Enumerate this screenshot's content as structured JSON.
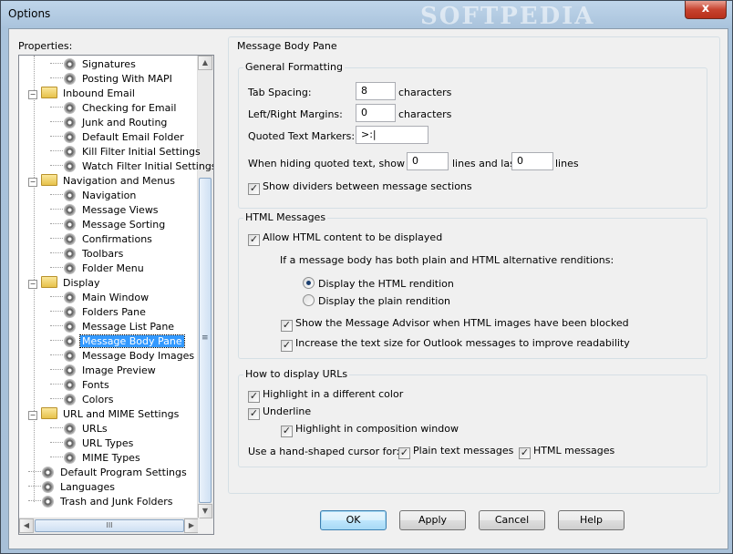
{
  "window": {
    "title": "Options",
    "watermark": "SOFTPEDIA",
    "close_label": "x"
  },
  "left": {
    "properties_label": "Properties:"
  },
  "tree": [
    {
      "label": "Signatures",
      "kind": "item",
      "level": 2
    },
    {
      "label": "Posting With MAPI",
      "kind": "item",
      "level": 2
    },
    {
      "label": "Inbound Email",
      "kind": "folder",
      "level": 1
    },
    {
      "label": "Checking for Email",
      "kind": "item",
      "level": 2
    },
    {
      "label": "Junk and Routing",
      "kind": "item",
      "level": 2
    },
    {
      "label": "Default Email Folder",
      "kind": "item",
      "level": 2
    },
    {
      "label": "Kill Filter Initial Settings",
      "kind": "item",
      "level": 2
    },
    {
      "label": "Watch Filter Initial Settings",
      "kind": "item",
      "level": 2
    },
    {
      "label": "Navigation and Menus",
      "kind": "folder",
      "level": 1
    },
    {
      "label": "Navigation",
      "kind": "item",
      "level": 2
    },
    {
      "label": "Message Views",
      "kind": "item",
      "level": 2
    },
    {
      "label": "Message Sorting",
      "kind": "item",
      "level": 2
    },
    {
      "label": "Confirmations",
      "kind": "item",
      "level": 2
    },
    {
      "label": "Toolbars",
      "kind": "item",
      "level": 2
    },
    {
      "label": "Folder Menu",
      "kind": "item",
      "level": 2
    },
    {
      "label": "Display",
      "kind": "folder",
      "level": 1
    },
    {
      "label": "Main Window",
      "kind": "item",
      "level": 2
    },
    {
      "label": "Folders Pane",
      "kind": "item",
      "level": 2
    },
    {
      "label": "Message List Pane",
      "kind": "item",
      "level": 2
    },
    {
      "label": "Message Body Pane",
      "kind": "item",
      "level": 2,
      "selected": true
    },
    {
      "label": "Message Body Images",
      "kind": "item",
      "level": 2
    },
    {
      "label": "Image Preview",
      "kind": "item",
      "level": 2
    },
    {
      "label": "Fonts",
      "kind": "item",
      "level": 2
    },
    {
      "label": "Colors",
      "kind": "item",
      "level": 2
    },
    {
      "label": "URL and MIME Settings",
      "kind": "folder",
      "level": 1
    },
    {
      "label": "URLs",
      "kind": "item",
      "level": 2
    },
    {
      "label": "URL Types",
      "kind": "item",
      "level": 2
    },
    {
      "label": "MIME Types",
      "kind": "item",
      "level": 2
    },
    {
      "label": "Default Program Settings",
      "kind": "item",
      "level": 1
    },
    {
      "label": "Languages",
      "kind": "item",
      "level": 1
    },
    {
      "label": "Trash and Junk Folders",
      "kind": "item",
      "level": 1
    }
  ],
  "main": {
    "title": "Message Body Pane",
    "general": {
      "title": "General Formatting",
      "tab_spacing_label": "Tab Spacing:",
      "tab_spacing_value": "8",
      "tab_spacing_unit": "characters",
      "margins_label": "Left/Right Margins:",
      "margins_value": "0",
      "margins_unit": "characters",
      "quoted_label": "Quoted Text Markers:",
      "quoted_value": ">:|",
      "hiding_prefix": "When hiding quoted text, show first",
      "first_value": "0",
      "hiding_middle": "lines and last",
      "last_value": "0",
      "hiding_suffix": "lines",
      "dividers_label": "Show dividers between message sections",
      "dividers_checked": true
    },
    "html": {
      "title": "HTML Messages",
      "allow_label": "Allow HTML content to be displayed",
      "allow_checked": true,
      "both_label": "If a message body has both plain and HTML alternative renditions:",
      "radio_html": "Display the HTML rendition",
      "radio_plain": "Display the plain rendition",
      "selected_radio": "html",
      "advisor_label": "Show the Message Advisor when HTML images have been blocked",
      "advisor_checked": true,
      "increase_label": "Increase the text size for Outlook messages to improve readability",
      "increase_checked": true
    },
    "urls": {
      "title": "How to display URLs",
      "highlight_label": "Highlight in a different color",
      "highlight_checked": true,
      "underline_label": "Underline",
      "underline_checked": true,
      "composition_label": "Highlight in composition window",
      "composition_checked": true,
      "cursor_label": "Use a hand-shaped cursor for:",
      "plain_label": "Plain text messages",
      "plain_checked": true,
      "htmlmsg_label": "HTML messages",
      "htmlmsg_checked": true
    }
  },
  "buttons": {
    "ok": "OK",
    "apply": "Apply",
    "cancel": "Cancel",
    "help": "Help"
  },
  "scroll": {
    "up": "▲",
    "down": "▼",
    "left": "◀",
    "right": "▶",
    "grip_v": "≡",
    "grip_h": "III"
  },
  "check_mark": "✓"
}
